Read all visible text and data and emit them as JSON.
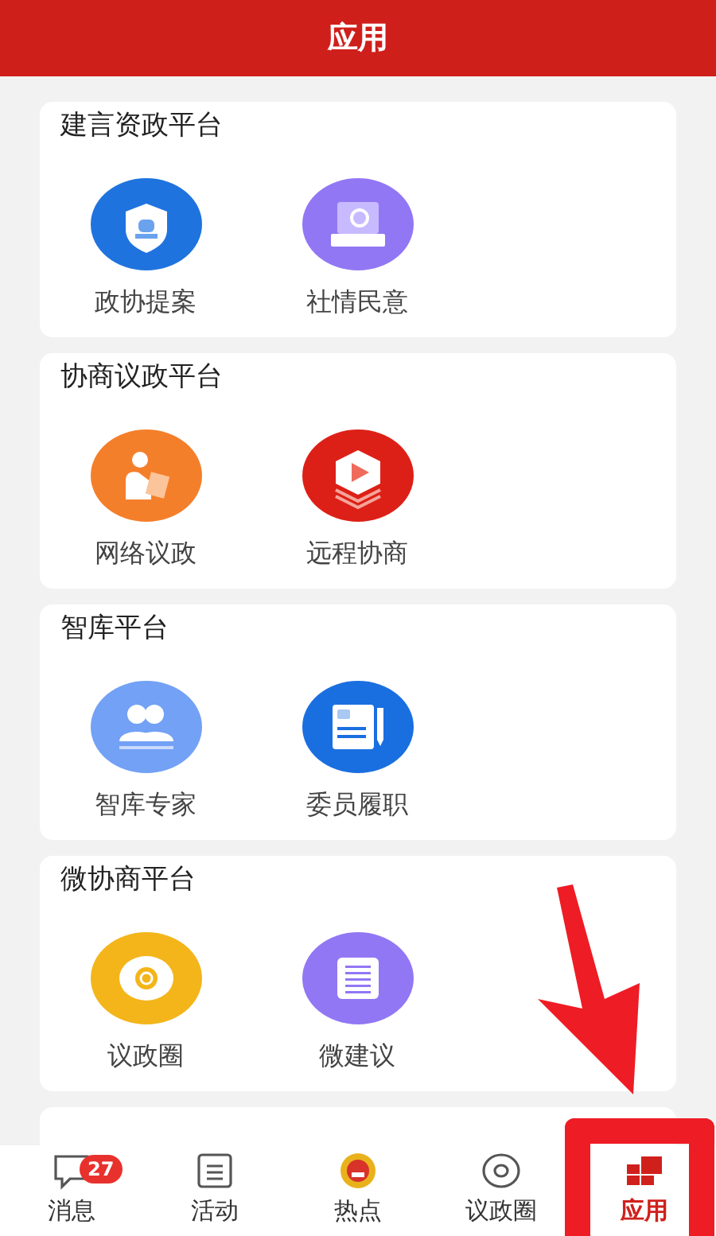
{
  "header": {
    "title": "应用"
  },
  "sections": [
    {
      "title": "建言资政平台",
      "items": [
        {
          "label": "政协提案",
          "kind": "shield"
        },
        {
          "label": "社情民意",
          "kind": "screen"
        }
      ]
    },
    {
      "title": "协商议政平台",
      "items": [
        {
          "label": "网络议政",
          "kind": "reader"
        },
        {
          "label": "远程协商",
          "kind": "video"
        }
      ]
    },
    {
      "title": "智库平台",
      "items": [
        {
          "label": "智库专家",
          "kind": "people"
        },
        {
          "label": "委员履职",
          "kind": "document"
        }
      ]
    },
    {
      "title": "微协商平台",
      "items": [
        {
          "label": "议政圈",
          "kind": "ring"
        },
        {
          "label": "微建议",
          "kind": "list"
        }
      ]
    }
  ],
  "tabs": [
    {
      "label": "消息",
      "kind": "chat",
      "badge": "27",
      "selected": false
    },
    {
      "label": "活动",
      "kind": "list",
      "selected": false
    },
    {
      "label": "热点",
      "kind": "emblem",
      "selected": false
    },
    {
      "label": "议政圈",
      "kind": "ring",
      "selected": false
    },
    {
      "label": "应用",
      "kind": "grid",
      "selected": true
    }
  ]
}
